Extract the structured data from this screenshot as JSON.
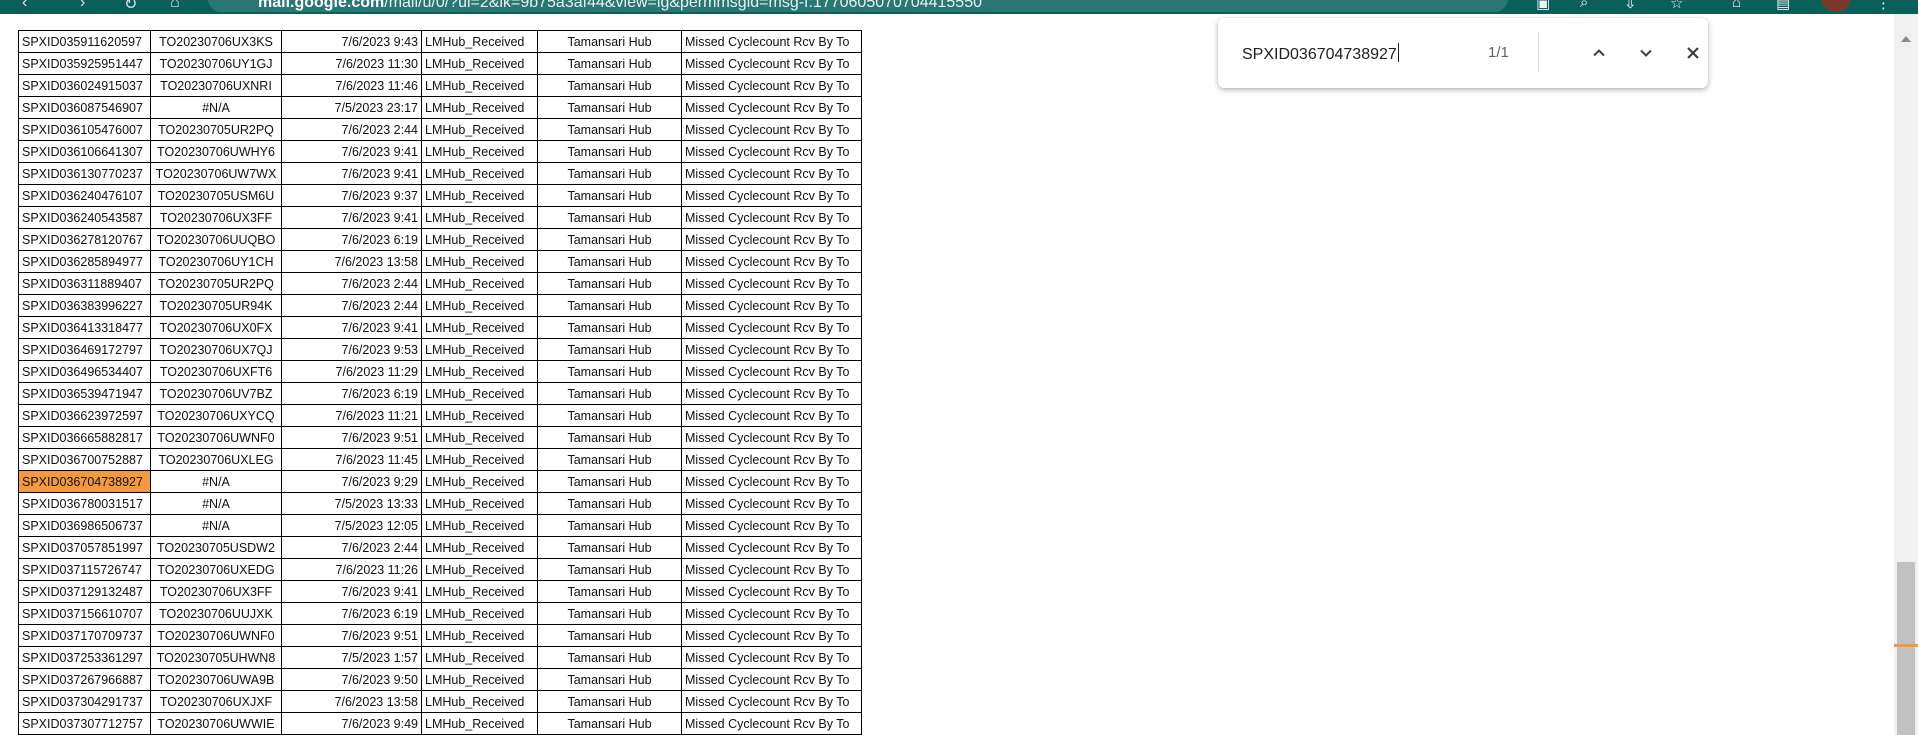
{
  "browser": {
    "url_host": "mail.google.com",
    "url_path": "/mail/u/0/?ui=2&ik=9b75a3af44&view=lg&permmsgid=msg-f:1770605070704415550"
  },
  "find": {
    "query": "SPXID036704738927",
    "count": "1/1"
  },
  "sheet": {
    "highlight_color": "#f59a3c",
    "rows": [
      [
        "SPXID035911620597",
        "TO20230706UX3KS",
        "7/6/2023 9:43",
        "LMHub_Received",
        "Tamansari Hub",
        "Missed Cyclecount Rcv By To"
      ],
      [
        "SPXID035925951447",
        "TO20230706UY1GJ",
        "7/6/2023 11:30",
        "LMHub_Received",
        "Tamansari Hub",
        "Missed Cyclecount Rcv By To"
      ],
      [
        "SPXID036024915037",
        "TO20230706UXNRI",
        "7/6/2023 11:46",
        "LMHub_Received",
        "Tamansari Hub",
        "Missed Cyclecount Rcv By To"
      ],
      [
        "SPXID036087546907",
        "#N/A",
        "7/5/2023 23:17",
        "LMHub_Received",
        "Tamansari Hub",
        "Missed Cyclecount Rcv By To"
      ],
      [
        "SPXID036105476007",
        "TO20230705UR2PQ",
        "7/6/2023 2:44",
        "LMHub_Received",
        "Tamansari Hub",
        "Missed Cyclecount Rcv By To"
      ],
      [
        "SPXID036106641307",
        "TO20230706UWHY6",
        "7/6/2023 9:41",
        "LMHub_Received",
        "Tamansari Hub",
        "Missed Cyclecount Rcv By To"
      ],
      [
        "SPXID036130770237",
        "TO20230706UW7WX",
        "7/6/2023 9:41",
        "LMHub_Received",
        "Tamansari Hub",
        "Missed Cyclecount Rcv By To"
      ],
      [
        "SPXID036240476107",
        "TO20230705USM6U",
        "7/6/2023 9:37",
        "LMHub_Received",
        "Tamansari Hub",
        "Missed Cyclecount Rcv By To"
      ],
      [
        "SPXID036240543587",
        "TO20230706UX3FF",
        "7/6/2023 9:41",
        "LMHub_Received",
        "Tamansari Hub",
        "Missed Cyclecount Rcv By To"
      ],
      [
        "SPXID036278120767",
        "TO20230706UUQBO",
        "7/6/2023 6:19",
        "LMHub_Received",
        "Tamansari Hub",
        "Missed Cyclecount Rcv By To"
      ],
      [
        "SPXID036285894977",
        "TO20230706UY1CH",
        "7/6/2023 13:58",
        "LMHub_Received",
        "Tamansari Hub",
        "Missed Cyclecount Rcv By To"
      ],
      [
        "SPXID036311889407",
        "TO20230705UR2PQ",
        "7/6/2023 2:44",
        "LMHub_Received",
        "Tamansari Hub",
        "Missed Cyclecount Rcv By To"
      ],
      [
        "SPXID036383996227",
        "TO20230705UR94K",
        "7/6/2023 2:44",
        "LMHub_Received",
        "Tamansari Hub",
        "Missed Cyclecount Rcv By To"
      ],
      [
        "SPXID036413318477",
        "TO20230706UX0FX",
        "7/6/2023 9:41",
        "LMHub_Received",
        "Tamansari Hub",
        "Missed Cyclecount Rcv By To"
      ],
      [
        "SPXID036469172797",
        "TO20230706UX7QJ",
        "7/6/2023 9:53",
        "LMHub_Received",
        "Tamansari Hub",
        "Missed Cyclecount Rcv By To"
      ],
      [
        "SPXID036496534407",
        "TO20230706UXFT6",
        "7/6/2023 11:29",
        "LMHub_Received",
        "Tamansari Hub",
        "Missed Cyclecount Rcv By To"
      ],
      [
        "SPXID036539471947",
        "TO20230706UV7BZ",
        "7/6/2023 6:19",
        "LMHub_Received",
        "Tamansari Hub",
        "Missed Cyclecount Rcv By To"
      ],
      [
        "SPXID036623972597",
        "TO20230706UXYCQ",
        "7/6/2023 11:21",
        "LMHub_Received",
        "Tamansari Hub",
        "Missed Cyclecount Rcv By To"
      ],
      [
        "SPXID036665882817",
        "TO20230706UWNF0",
        "7/6/2023 9:51",
        "LMHub_Received",
        "Tamansari Hub",
        "Missed Cyclecount Rcv By To"
      ],
      [
        "SPXID036700752887",
        "TO20230706UXLEG",
        "7/6/2023 11:45",
        "LMHub_Received",
        "Tamansari Hub",
        "Missed Cyclecount Rcv By To"
      ],
      [
        "SPXID036704738927",
        "#N/A",
        "7/6/2023 9:29",
        "LMHub_Received",
        "Tamansari Hub",
        "Missed Cyclecount Rcv By To"
      ],
      [
        "SPXID036780031517",
        "#N/A",
        "7/5/2023 13:33",
        "LMHub_Received",
        "Tamansari Hub",
        "Missed Cyclecount Rcv By To"
      ],
      [
        "SPXID036986506737",
        "#N/A",
        "7/5/2023 12:05",
        "LMHub_Received",
        "Tamansari Hub",
        "Missed Cyclecount Rcv By To"
      ],
      [
        "SPXID037057851997",
        "TO20230705USDW2",
        "7/6/2023 2:44",
        "LMHub_Received",
        "Tamansari Hub",
        "Missed Cyclecount Rcv By To"
      ],
      [
        "SPXID037115726747",
        "TO20230706UXEDG",
        "7/6/2023 11:26",
        "LMHub_Received",
        "Tamansari Hub",
        "Missed Cyclecount Rcv By To"
      ],
      [
        "SPXID037129132487",
        "TO20230706UX3FF",
        "7/6/2023 9:41",
        "LMHub_Received",
        "Tamansari Hub",
        "Missed Cyclecount Rcv By To"
      ],
      [
        "SPXID037156610707",
        "TO20230706UUJXK",
        "7/6/2023 6:19",
        "LMHub_Received",
        "Tamansari Hub",
        "Missed Cyclecount Rcv By To"
      ],
      [
        "SPXID037170709737",
        "TO20230706UWNF0",
        "7/6/2023 9:51",
        "LMHub_Received",
        "Tamansari Hub",
        "Missed Cyclecount Rcv By To"
      ],
      [
        "SPXID037253361297",
        "TO20230705UHWN8",
        "7/5/2023 1:57",
        "LMHub_Received",
        "Tamansari Hub",
        "Missed Cyclecount Rcv By To"
      ],
      [
        "SPXID037267966887",
        "TO20230706UWA9B",
        "7/6/2023 9:50",
        "LMHub_Received",
        "Tamansari Hub",
        "Missed Cyclecount Rcv By To"
      ],
      [
        "SPXID037304291737",
        "TO20230706UXJXF",
        "7/6/2023 13:58",
        "LMHub_Received",
        "Tamansari Hub",
        "Missed Cyclecount Rcv By To"
      ],
      [
        "SPXID037307712757",
        "TO20230706UWWIE",
        "7/6/2023 9:49",
        "LMHub_Received",
        "Tamansari Hub",
        "Missed Cyclecount Rcv By To"
      ]
    ]
  }
}
